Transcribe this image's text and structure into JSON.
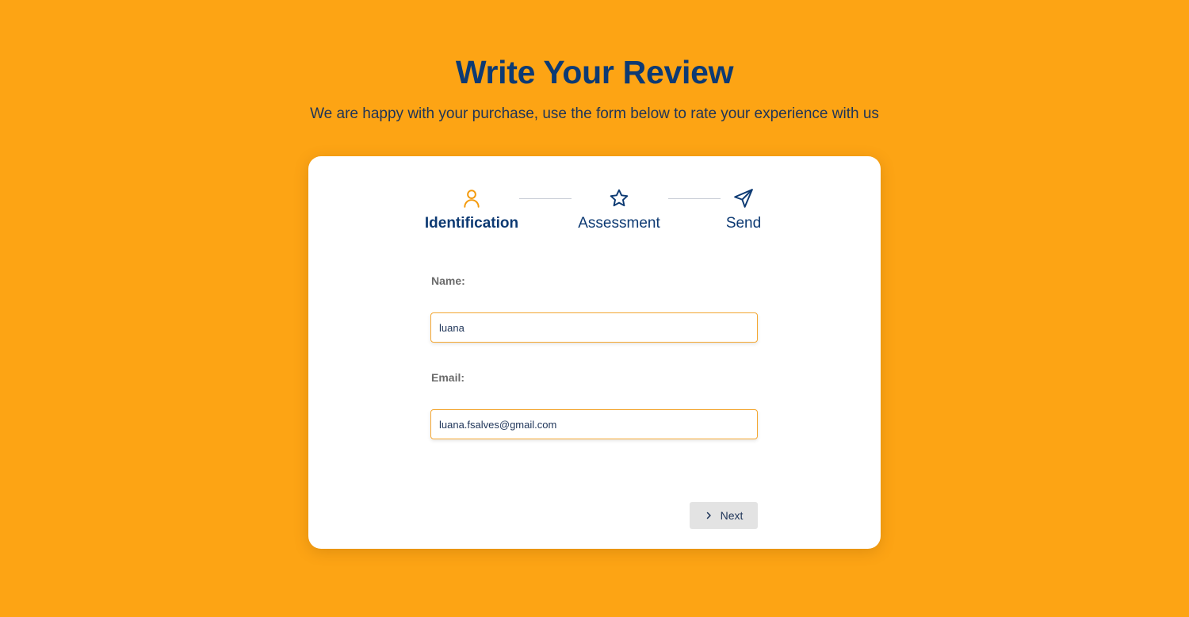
{
  "header": {
    "title": "Write Your Review",
    "subtitle": "We are happy with your purchase, use the form below to rate your experience with us"
  },
  "steps": [
    {
      "label": "Identification",
      "icon": "user-icon",
      "active": true
    },
    {
      "label": "Assessment",
      "icon": "star-icon",
      "active": false
    },
    {
      "label": "Send",
      "icon": "send-icon",
      "active": false
    }
  ],
  "form": {
    "name_label": "Name:",
    "name_value": "luana",
    "email_label": "Email:",
    "email_value": "luana.fsalves@gmail.com"
  },
  "actions": {
    "next_label": "Next",
    "next_icon": "chevron-right-icon"
  },
  "colors": {
    "background": "#FDA414",
    "primary": "#0D3A73",
    "accent": "#F49A0C",
    "input_border": "#F4A732"
  }
}
